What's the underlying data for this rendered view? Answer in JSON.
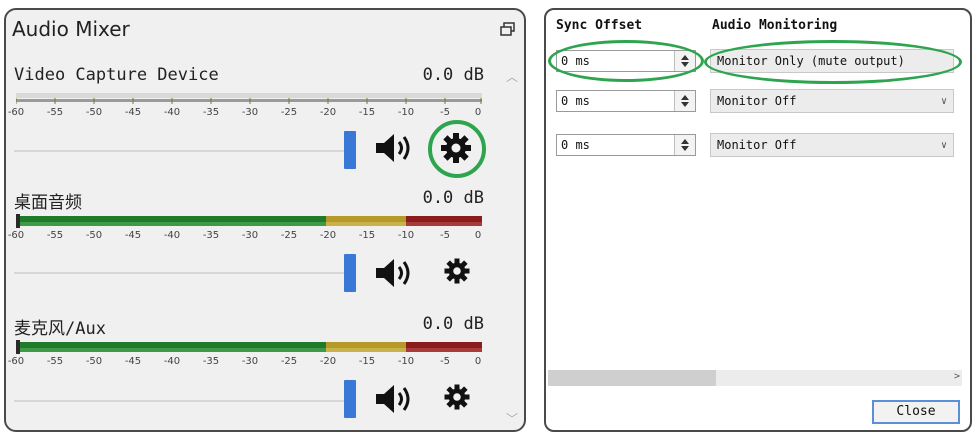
{
  "mixer": {
    "title": "Audio Mixer",
    "channels": [
      {
        "name": "Video Capture Device",
        "db": "0.0 dB",
        "volume": 1.0
      },
      {
        "name": "桌面音频",
        "db": "0.0 dB",
        "volume": 1.0
      },
      {
        "name": "麦克风/Aux",
        "db": "0.0 dB",
        "volume": 1.0
      }
    ],
    "ticks": [
      "-60",
      "-55",
      "-50",
      "-45",
      "-40",
      "-35",
      "-30",
      "-25",
      "-20",
      "-15",
      "-10",
      "-5",
      "0"
    ],
    "icons": {
      "float": "float-window-icon",
      "mute": "speaker-icon",
      "settings": "gear-icon"
    }
  },
  "advanced": {
    "headers": {
      "sync": "Sync Offset",
      "monitoring": "Audio Monitoring"
    },
    "rows": [
      {
        "offset": "0 ms",
        "monitoring": "Monitor Only (mute output)"
      },
      {
        "offset": "0 ms",
        "monitoring": "Monitor Off"
      },
      {
        "offset": "0 ms",
        "monitoring": "Monitor Off"
      }
    ],
    "close_label": "Close"
  },
  "colors": {
    "highlight": "#2ea44f",
    "slider": "#3a78d8",
    "meter_green": "#1f7a2a",
    "meter_yellow": "#b59a2a",
    "meter_red": "#8a1c1c"
  }
}
